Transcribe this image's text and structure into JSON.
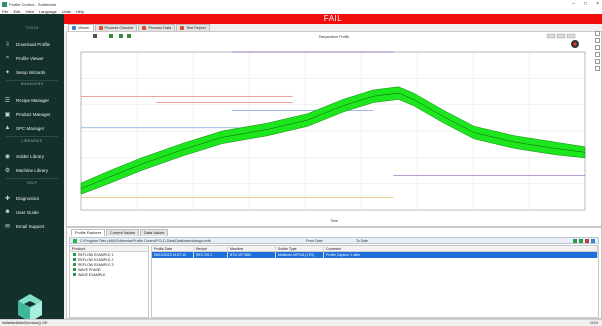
{
  "window": {
    "title": "Profile Control - Solderstar"
  },
  "menu": [
    "File",
    "Edit",
    "View",
    "Language",
    "Units",
    "Help"
  ],
  "sidebar": {
    "sections": [
      {
        "heading": "TOOLS",
        "items": [
          {
            "label": "Download Profile",
            "icon": "download-icon"
          },
          {
            "label": "Profile Viewer",
            "icon": "chart-icon"
          },
          {
            "label": "Setup Wizards",
            "icon": "wizard-icon"
          }
        ]
      },
      {
        "heading": "MANAGERS",
        "items": [
          {
            "label": "Recipe Manager",
            "icon": "recipe-icon"
          },
          {
            "label": "Product Manager",
            "icon": "product-icon"
          },
          {
            "label": "SPC Manager",
            "icon": "spc-icon"
          }
        ]
      },
      {
        "heading": "LIBRARIES",
        "items": [
          {
            "label": "Solder Library",
            "icon": "solder-icon"
          },
          {
            "label": "Machine Library",
            "icon": "machine-icon"
          }
        ]
      },
      {
        "heading": "HELP",
        "items": [
          {
            "label": "Diagnostics",
            "icon": "diagnostics-icon"
          },
          {
            "label": "User Guide",
            "icon": "user-guide-icon"
          },
          {
            "label": "Email Support",
            "icon": "email-icon"
          }
        ]
      }
    ]
  },
  "status_banner": {
    "text": "FAIL",
    "color": "#f20d0d"
  },
  "viewer_tabs": [
    "Viewer",
    "Process Checker",
    "Process Data",
    "Test Report"
  ],
  "chart_data": {
    "type": "line",
    "title": "Temperature Profile",
    "ylabel": "",
    "xlabel": "Time",
    "band_color": "#1ee61e",
    "xlim": [
      0,
      1
    ],
    "ylim": [
      0,
      1
    ],
    "band": [
      {
        "x": 0.0,
        "lo": 0.1,
        "hi": 0.17
      },
      {
        "x": 0.05,
        "lo": 0.16,
        "hi": 0.24
      },
      {
        "x": 0.12,
        "lo": 0.25,
        "hi": 0.33
      },
      {
        "x": 0.2,
        "lo": 0.34,
        "hi": 0.42
      },
      {
        "x": 0.28,
        "lo": 0.42,
        "hi": 0.5
      },
      {
        "x": 0.37,
        "lo": 0.47,
        "hi": 0.55
      },
      {
        "x": 0.45,
        "lo": 0.53,
        "hi": 0.61
      },
      {
        "x": 0.52,
        "lo": 0.62,
        "hi": 0.7
      },
      {
        "x": 0.58,
        "lo": 0.68,
        "hi": 0.76
      },
      {
        "x": 0.63,
        "lo": 0.7,
        "hi": 0.78
      },
      {
        "x": 0.66,
        "lo": 0.66,
        "hi": 0.74
      },
      {
        "x": 0.72,
        "lo": 0.55,
        "hi": 0.63
      },
      {
        "x": 0.78,
        "lo": 0.45,
        "hi": 0.53
      },
      {
        "x": 0.86,
        "lo": 0.39,
        "hi": 0.47
      },
      {
        "x": 0.94,
        "lo": 0.35,
        "hi": 0.43
      },
      {
        "x": 1.0,
        "lo": 0.33,
        "hi": 0.4
      }
    ]
  },
  "bottom_tabs": [
    "Profile Explorer",
    "Current Values",
    "Data Values"
  ],
  "path": "C:\\Program Files (x86)\\Solderstar\\Profile Control\\PCLD-Data\\Database\\dataqyx.mdb",
  "path_filters": {
    "from_label": "From Date",
    "to_label": "To Date"
  },
  "products": {
    "header": "Product",
    "items": [
      "REFLOW EXAMPLE 1",
      "REFLOW EXAMPLE 2",
      "REFLOW EXAMPLE 3",
      "WAVE PHASE",
      "WAVE EXAMPLE"
    ]
  },
  "profiles_table": {
    "columns": [
      "Profile Date",
      "Recipe",
      "Machine",
      "Solder Type",
      "Comment"
    ],
    "rows": [
      [
        "06/10/2023 14:57:10",
        "REC-RS 1",
        "BTU VIP 88N",
        "Multicore MP218 (17N)",
        "Profile Capture 1 after"
      ]
    ]
  },
  "statusbar": {
    "left": "InitialiseMainServices() OK",
    "right": "NUM"
  }
}
